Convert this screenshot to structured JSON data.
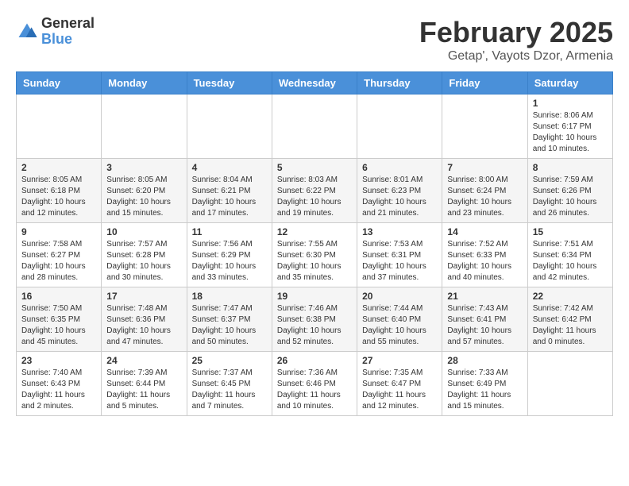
{
  "header": {
    "logo_general": "General",
    "logo_blue": "Blue",
    "month_title": "February 2025",
    "location": "Getap', Vayots Dzor, Armenia"
  },
  "days_of_week": [
    "Sunday",
    "Monday",
    "Tuesday",
    "Wednesday",
    "Thursday",
    "Friday",
    "Saturday"
  ],
  "weeks": [
    [
      {
        "day": "",
        "info": ""
      },
      {
        "day": "",
        "info": ""
      },
      {
        "day": "",
        "info": ""
      },
      {
        "day": "",
        "info": ""
      },
      {
        "day": "",
        "info": ""
      },
      {
        "day": "",
        "info": ""
      },
      {
        "day": "1",
        "info": "Sunrise: 8:06 AM\nSunset: 6:17 PM\nDaylight: 10 hours and 10 minutes."
      }
    ],
    [
      {
        "day": "2",
        "info": "Sunrise: 8:05 AM\nSunset: 6:18 PM\nDaylight: 10 hours and 12 minutes."
      },
      {
        "day": "3",
        "info": "Sunrise: 8:05 AM\nSunset: 6:20 PM\nDaylight: 10 hours and 15 minutes."
      },
      {
        "day": "4",
        "info": "Sunrise: 8:04 AM\nSunset: 6:21 PM\nDaylight: 10 hours and 17 minutes."
      },
      {
        "day": "5",
        "info": "Sunrise: 8:03 AM\nSunset: 6:22 PM\nDaylight: 10 hours and 19 minutes."
      },
      {
        "day": "6",
        "info": "Sunrise: 8:01 AM\nSunset: 6:23 PM\nDaylight: 10 hours and 21 minutes."
      },
      {
        "day": "7",
        "info": "Sunrise: 8:00 AM\nSunset: 6:24 PM\nDaylight: 10 hours and 23 minutes."
      },
      {
        "day": "8",
        "info": "Sunrise: 7:59 AM\nSunset: 6:26 PM\nDaylight: 10 hours and 26 minutes."
      }
    ],
    [
      {
        "day": "9",
        "info": "Sunrise: 7:58 AM\nSunset: 6:27 PM\nDaylight: 10 hours and 28 minutes."
      },
      {
        "day": "10",
        "info": "Sunrise: 7:57 AM\nSunset: 6:28 PM\nDaylight: 10 hours and 30 minutes."
      },
      {
        "day": "11",
        "info": "Sunrise: 7:56 AM\nSunset: 6:29 PM\nDaylight: 10 hours and 33 minutes."
      },
      {
        "day": "12",
        "info": "Sunrise: 7:55 AM\nSunset: 6:30 PM\nDaylight: 10 hours and 35 minutes."
      },
      {
        "day": "13",
        "info": "Sunrise: 7:53 AM\nSunset: 6:31 PM\nDaylight: 10 hours and 37 minutes."
      },
      {
        "day": "14",
        "info": "Sunrise: 7:52 AM\nSunset: 6:33 PM\nDaylight: 10 hours and 40 minutes."
      },
      {
        "day": "15",
        "info": "Sunrise: 7:51 AM\nSunset: 6:34 PM\nDaylight: 10 hours and 42 minutes."
      }
    ],
    [
      {
        "day": "16",
        "info": "Sunrise: 7:50 AM\nSunset: 6:35 PM\nDaylight: 10 hours and 45 minutes."
      },
      {
        "day": "17",
        "info": "Sunrise: 7:48 AM\nSunset: 6:36 PM\nDaylight: 10 hours and 47 minutes."
      },
      {
        "day": "18",
        "info": "Sunrise: 7:47 AM\nSunset: 6:37 PM\nDaylight: 10 hours and 50 minutes."
      },
      {
        "day": "19",
        "info": "Sunrise: 7:46 AM\nSunset: 6:38 PM\nDaylight: 10 hours and 52 minutes."
      },
      {
        "day": "20",
        "info": "Sunrise: 7:44 AM\nSunset: 6:40 PM\nDaylight: 10 hours and 55 minutes."
      },
      {
        "day": "21",
        "info": "Sunrise: 7:43 AM\nSunset: 6:41 PM\nDaylight: 10 hours and 57 minutes."
      },
      {
        "day": "22",
        "info": "Sunrise: 7:42 AM\nSunset: 6:42 PM\nDaylight: 11 hours and 0 minutes."
      }
    ],
    [
      {
        "day": "23",
        "info": "Sunrise: 7:40 AM\nSunset: 6:43 PM\nDaylight: 11 hours and 2 minutes."
      },
      {
        "day": "24",
        "info": "Sunrise: 7:39 AM\nSunset: 6:44 PM\nDaylight: 11 hours and 5 minutes."
      },
      {
        "day": "25",
        "info": "Sunrise: 7:37 AM\nSunset: 6:45 PM\nDaylight: 11 hours and 7 minutes."
      },
      {
        "day": "26",
        "info": "Sunrise: 7:36 AM\nSunset: 6:46 PM\nDaylight: 11 hours and 10 minutes."
      },
      {
        "day": "27",
        "info": "Sunrise: 7:35 AM\nSunset: 6:47 PM\nDaylight: 11 hours and 12 minutes."
      },
      {
        "day": "28",
        "info": "Sunrise: 7:33 AM\nSunset: 6:49 PM\nDaylight: 11 hours and 15 minutes."
      },
      {
        "day": "",
        "info": ""
      }
    ]
  ]
}
